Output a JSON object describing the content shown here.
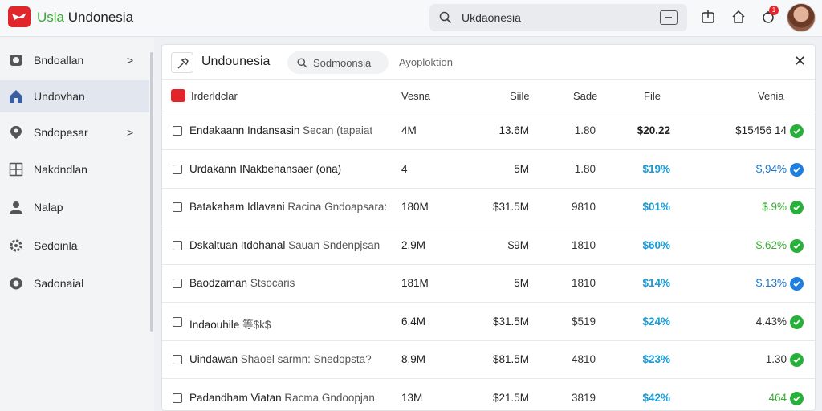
{
  "app": {
    "brand_part1": "Usla",
    "brand_part2": "Undonesia"
  },
  "search": {
    "value": "Ukdaonesia"
  },
  "notifications": {
    "count": "1"
  },
  "sidebar": {
    "items": [
      {
        "label": "Bndoallan",
        "icon": "camera-icon",
        "has_chevron": true
      },
      {
        "label": "Undovhan",
        "icon": "home-icon",
        "active": true
      },
      {
        "label": "Sndopesar",
        "icon": "location-pin-icon",
        "has_chevron": true
      },
      {
        "label": "Nakdndlan",
        "icon": "grid-icon"
      },
      {
        "label": "Nalap",
        "icon": "user-icon"
      },
      {
        "label": "Sedoinla",
        "icon": "gear-icon"
      },
      {
        "label": "Sadonaial",
        "icon": "circle-icon"
      }
    ]
  },
  "panel": {
    "title": "Undounesia",
    "chip_label": "Sodmoonsia",
    "subtitle": "Ayoploktion",
    "close": "✕"
  },
  "table": {
    "headers": [
      "Irderldclar",
      "Vesna",
      "Siile",
      "Sade",
      "File",
      "Venia"
    ],
    "rows": [
      {
        "name": "Endakaann Indansasin",
        "sub": " Secan (tapaiat",
        "c1": "4M",
        "c2": "13.6M",
        "c3": "1.80",
        "c4": "$20.22",
        "c4_color": "#222222",
        "c5": "$15456 14",
        "c5_color": "#222222",
        "status": "green"
      },
      {
        "name": "Urdakann INakbehansaer (ona)",
        "sub": "",
        "c1": "4",
        "c2": "5M",
        "c3": "1.80",
        "c4": "$19%",
        "c4_color": "#1a9bd6",
        "c5": "$,94%",
        "c5_color": "#1a73c8",
        "status": "blue"
      },
      {
        "name": "Batakaham Idlavani",
        "sub": " Racina Gndoapsara:",
        "c1": "180M",
        "c2": "$31.5M",
        "c3": "9810",
        "c4": "$01%",
        "c4_color": "#1a9bd6",
        "c5": "$.9%",
        "c5_color": "#3aa935",
        "status": "green"
      },
      {
        "name": "Dskaltuan Itdohanal",
        "sub": " Sauan Sndenpjsan",
        "c1": "2.9M",
        "c2": "$9M",
        "c3": "1810",
        "c4": "$60%",
        "c4_color": "#1a9bd6",
        "c5": "$.62%",
        "c5_color": "#3aa935",
        "status": "green"
      },
      {
        "name": "Baodzaman",
        "sub": " Stsocaris",
        "c1": "181M",
        "c2": "5M",
        "c3": "1810",
        "c4": "$14%",
        "c4_color": "#1a9bd6",
        "c5": "$.13%",
        "c5_color": "#1a73c8",
        "status": "blue"
      },
      {
        "name": "Indaouhile",
        "sub": " 等$k$",
        "c1": "6.4M",
        "c2": "$31.5M",
        "c3": "$519",
        "c4": "$24%",
        "c4_color": "#1a9bd6",
        "c5": "4.43%",
        "c5_color": "#333333",
        "status": "green"
      },
      {
        "name": "Uindawan",
        "sub": "  Shaoel sarmn: Snedopsta?",
        "c1": "8.9M",
        "c2": "$81.5M",
        "c3": "4810",
        "c4": "$23%",
        "c4_color": "#1a9bd6",
        "c5": "1.30",
        "c5_color": "#333333",
        "status": "green"
      },
      {
        "name": "Padandham Viatan",
        "sub": " Racma Gndoopjan",
        "c1": "13M",
        "c2": "$21.5M",
        "c3": "3819",
        "c4": "$42%",
        "c4_color": "#1a9bd6",
        "c5": "464",
        "c5_color": "#3aa935",
        "status": "green"
      }
    ]
  },
  "colors": {
    "accent_red": "#e0262b",
    "green": "#28b13a",
    "blue": "#1f7fe0"
  }
}
